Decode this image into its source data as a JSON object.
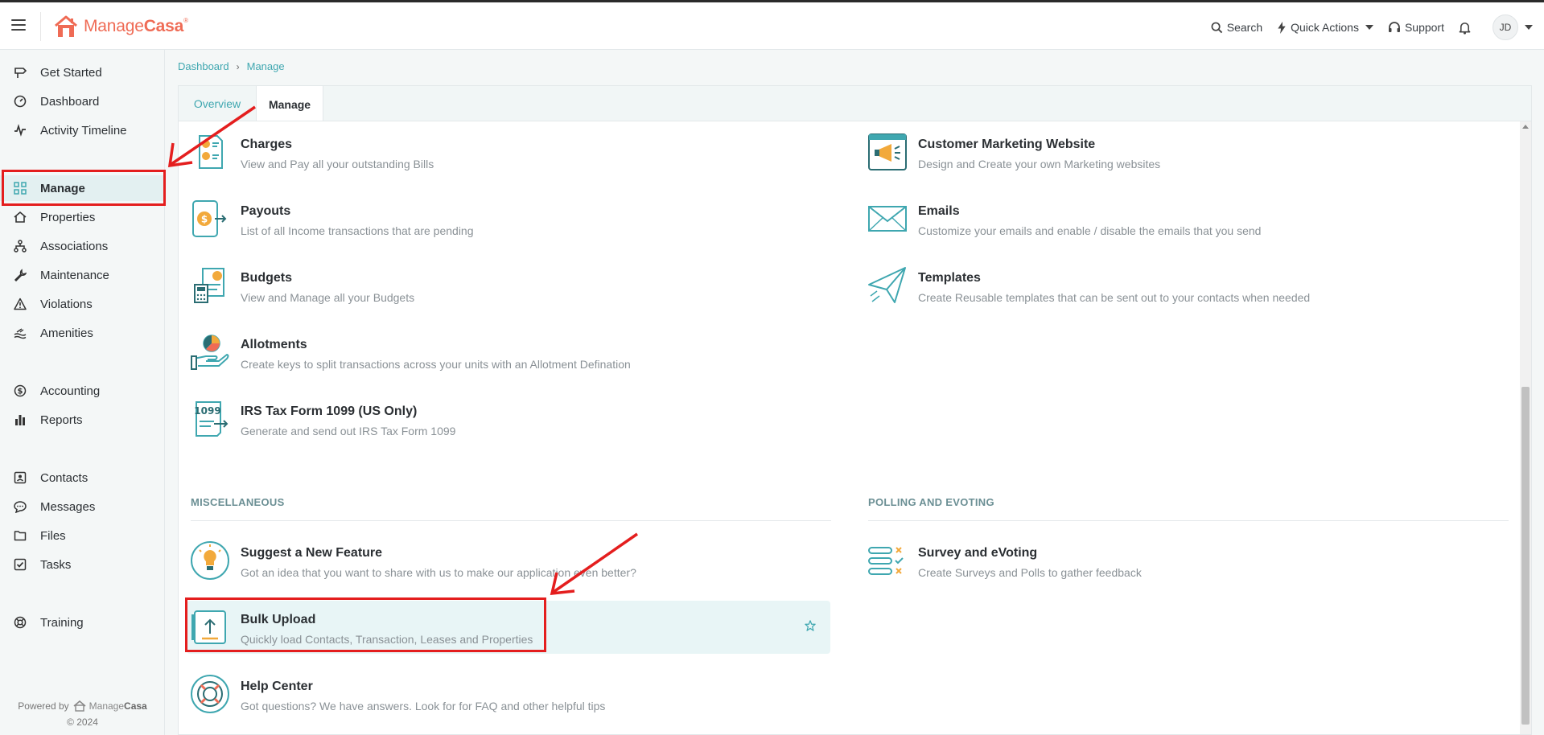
{
  "app": {
    "logo_manage": "Manage",
    "logo_casa": "Casa",
    "logo_reg": "®"
  },
  "topbar": {
    "search": "Search",
    "quick_actions": "Quick Actions",
    "support": "Support",
    "avatar": "JD"
  },
  "sidebar": {
    "items": [
      {
        "label": "Get Started",
        "icon": "signpost-icon"
      },
      {
        "label": "Dashboard",
        "icon": "gauge-icon"
      },
      {
        "label": "Activity Timeline",
        "icon": "pulse-icon"
      },
      {
        "label": "Manage",
        "icon": "grid-icon"
      },
      {
        "label": "Properties",
        "icon": "house-icon"
      },
      {
        "label": "Associations",
        "icon": "hierarchy-icon"
      },
      {
        "label": "Maintenance",
        "icon": "wrench-icon"
      },
      {
        "label": "Violations",
        "icon": "warning-icon"
      },
      {
        "label": "Amenities",
        "icon": "pool-icon"
      },
      {
        "label": "Accounting",
        "icon": "dollar-icon"
      },
      {
        "label": "Reports",
        "icon": "bar-chart-icon"
      },
      {
        "label": "Contacts",
        "icon": "contact-card-icon"
      },
      {
        "label": "Messages",
        "icon": "chat-icon"
      },
      {
        "label": "Files",
        "icon": "folder-icon"
      },
      {
        "label": "Tasks",
        "icon": "checkbox-icon"
      },
      {
        "label": "Training",
        "icon": "lifebuoy-icon"
      }
    ],
    "active": "Manage",
    "footer_powered": "Powered by",
    "footer_brand_a": "Manage",
    "footer_brand_b": "Casa",
    "footer_copy": "© 2024"
  },
  "breadcrumb": {
    "items": [
      "Dashboard",
      "Manage"
    ]
  },
  "tabs": {
    "overview": "Overview",
    "manage": "Manage"
  },
  "left_items": [
    {
      "title": "Charges",
      "desc": "View and Pay all your outstanding Bills"
    },
    {
      "title": "Payouts",
      "desc": "List of all Income transactions that are pending"
    },
    {
      "title": "Budgets",
      "desc": "View and Manage all your Budgets"
    },
    {
      "title": "Allotments",
      "desc": "Create keys to split transactions across your units with an Allotment Defination"
    },
    {
      "title": "IRS Tax Form 1099 (US Only)",
      "desc": "Generate and send out IRS Tax Form 1099"
    }
  ],
  "right_items": [
    {
      "title": "Customer Marketing Website",
      "desc": "Design and Create your own Marketing websites"
    },
    {
      "title": "Emails",
      "desc": "Customize your emails and enable / disable the emails that you send"
    },
    {
      "title": "Templates",
      "desc": "Create Reusable templates that can be sent out to your contacts when needed"
    }
  ],
  "misc": {
    "heading": "MISCELLANEOUS",
    "items": [
      {
        "title": "Suggest a New Feature",
        "desc": "Got an idea that you want to share with us to make our application even better?"
      },
      {
        "title": "Bulk Upload",
        "desc": "Quickly load Contacts, Transaction, Leases and Properties"
      },
      {
        "title": "Help Center",
        "desc": "Got questions? We have answers. Look for for FAQ and other helpful tips"
      }
    ]
  },
  "polling": {
    "heading": "POLLING AND EVOTING",
    "items": [
      {
        "title": "Survey and eVoting",
        "desc": "Create Surveys and Polls to gather feedback"
      }
    ]
  },
  "icon_text": {
    "irs_1099": "1099"
  },
  "colors": {
    "teal": "#3fa7b0",
    "orange": "#f2a93b",
    "brand": "#ef6b55",
    "annotation_red": "#e41e1e"
  }
}
